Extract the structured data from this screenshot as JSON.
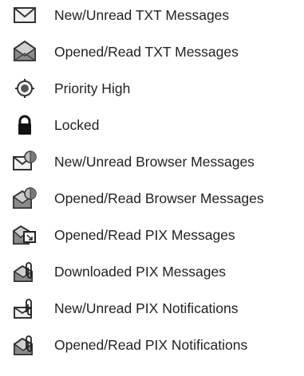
{
  "legend": {
    "items": [
      {
        "icon": "envelope-closed-icon",
        "label": "New/Unread TXT Messages"
      },
      {
        "icon": "envelope-open-icon",
        "label": "Opened/Read TXT Messages"
      },
      {
        "icon": "priority-high-icon",
        "label": "Priority High"
      },
      {
        "icon": "lock-icon",
        "label": "Locked"
      },
      {
        "icon": "browser-message-unread-icon",
        "label": "New/Unread Browser Messages"
      },
      {
        "icon": "browser-message-read-icon",
        "label": "Opened/Read Browser Messages"
      },
      {
        "icon": "pix-message-read-icon",
        "label": "Opened/Read PIX Messages"
      },
      {
        "icon": "pix-downloaded-icon",
        "label": "Downloaded PIX Messages"
      },
      {
        "icon": "pix-notification-unread-icon",
        "label": "New/Unread PIX Notifications"
      },
      {
        "icon": "pix-notification-read-icon",
        "label": "Opened/Read PIX Notifications"
      }
    ]
  }
}
